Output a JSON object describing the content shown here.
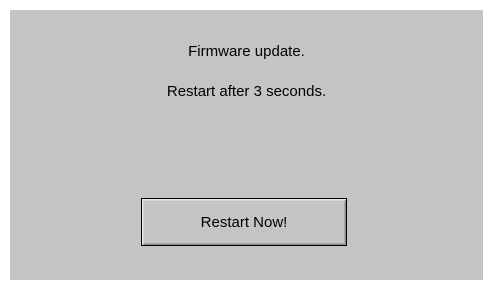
{
  "dialog": {
    "title": "Firmware update.",
    "message": "Restart after 3 seconds.",
    "restart_button_label": "Restart Now!"
  },
  "colors": {
    "panel_background": "#c4c4c4",
    "text": "#000000"
  }
}
